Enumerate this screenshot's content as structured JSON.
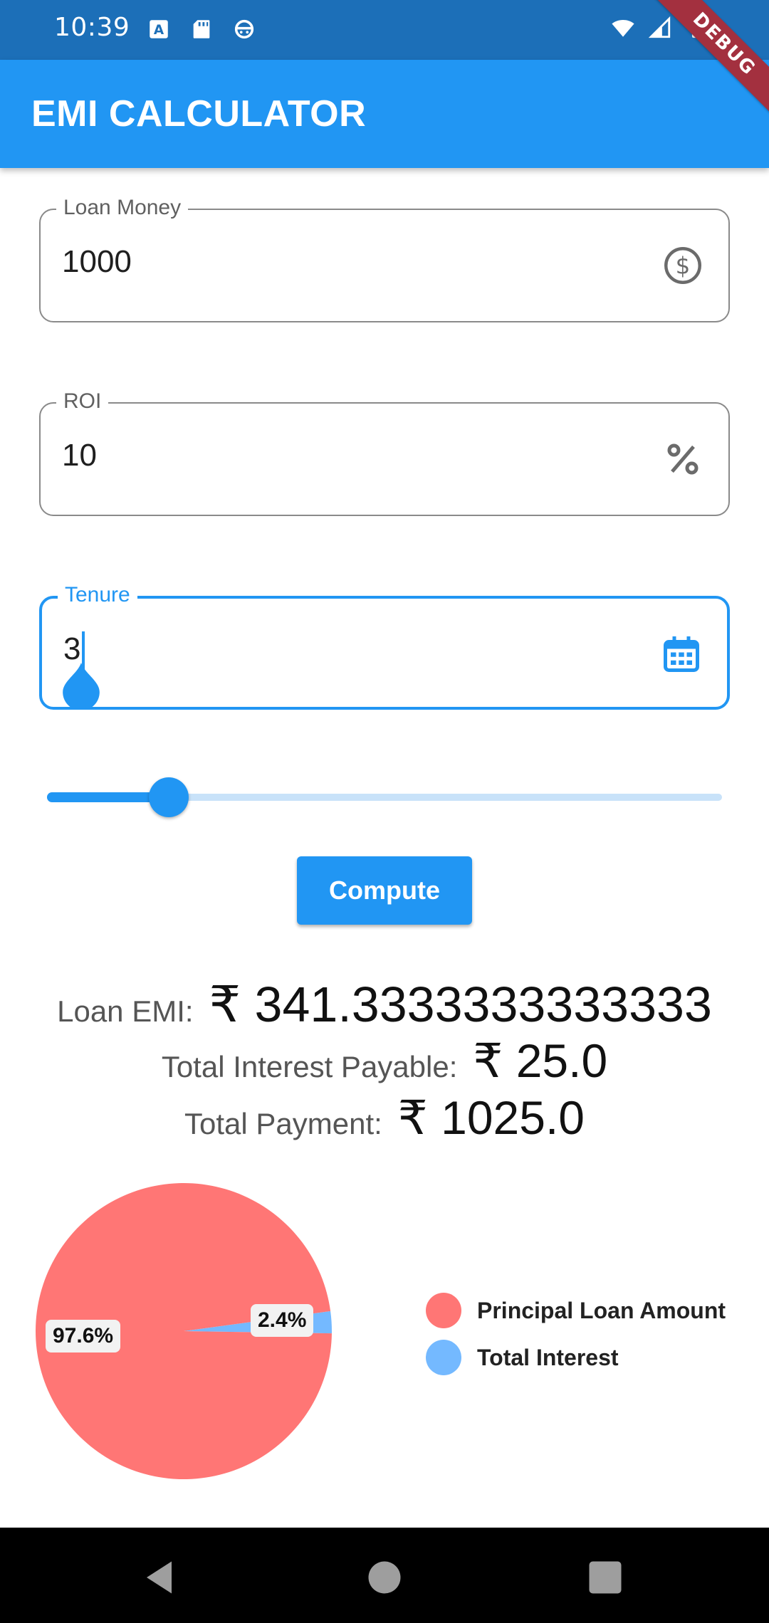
{
  "status_bar": {
    "time": "10:39",
    "left_icons": [
      "a-box-icon",
      "sd-card-icon",
      "face-icon"
    ],
    "right_icons": [
      "wifi-icon",
      "signal-icon",
      "battery-icon"
    ]
  },
  "debug_banner": "DEBUG",
  "app_bar": {
    "title": "EMI CALCULATOR"
  },
  "fields": {
    "loan_money": {
      "label": "Loan Money",
      "value": "1000",
      "icon": "dollar-circle-icon"
    },
    "roi": {
      "label": "ROI",
      "value": "10",
      "icon": "percent-icon"
    },
    "tenure": {
      "label": "Tenure",
      "value": "3",
      "icon": "calendar-icon"
    }
  },
  "slider": {
    "level_fraction": 0.18
  },
  "compute_button": {
    "label": "Compute"
  },
  "results": {
    "emi_label": "Loan EMI:",
    "emi_value": "₹ 341.3333333333333",
    "interest_label": "Total Interest Payable:",
    "interest_value": "₹ 25.0",
    "payment_label": "Total Payment:",
    "payment_value": "₹ 1025.0"
  },
  "chart_data": {
    "type": "pie",
    "slices": [
      {
        "name": "Principal Loan Amount",
        "value": 97.6,
        "label": "97.6%",
        "color": "#ff7675"
      },
      {
        "name": "Total Interest",
        "value": 2.4,
        "label": "2.4%",
        "color": "#74b9ff"
      }
    ],
    "legend_position": "right"
  },
  "nav_bar": {
    "buttons": [
      "back-icon",
      "home-icon",
      "recents-icon"
    ]
  }
}
